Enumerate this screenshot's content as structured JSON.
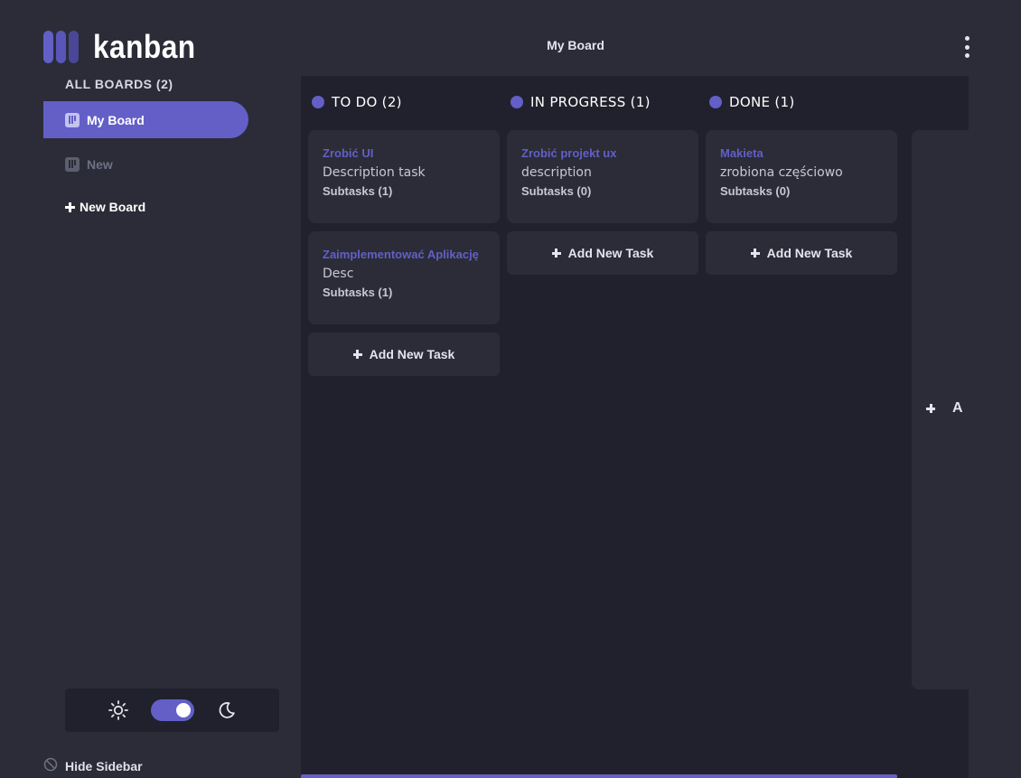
{
  "app": {
    "logo_text": "kanban",
    "board_title": "My Board"
  },
  "sidebar": {
    "all_boards_label": "ALL BOARDS (2)",
    "boards": [
      {
        "label": "My Board",
        "active": true
      },
      {
        "label": "New",
        "active": false
      }
    ],
    "new_board_label": "New Board",
    "hide_sidebar_label": "Hide Sidebar",
    "theme": {
      "mode": "dark",
      "light_icon": "sun-icon",
      "dark_icon": "moon-icon"
    }
  },
  "columns": [
    {
      "header": "TO DO (2)",
      "tasks": [
        {
          "title": "Zrobić UI",
          "description": "Description task",
          "subtasks": "Subtasks (1)"
        },
        {
          "title": "Zaimplementować Aplikację",
          "description": "Desc",
          "subtasks": "Subtasks (1)"
        }
      ],
      "add_task_label": "Add New Task"
    },
    {
      "header": "IN PROGRESS (1)",
      "tasks": [
        {
          "title": "Zrobić projekt ux",
          "description": "description",
          "subtasks": "Subtasks (0)"
        }
      ],
      "add_task_label": "Add New Task"
    },
    {
      "header": "DONE (1)",
      "tasks": [
        {
          "title": "Makieta",
          "description": "zrobiona częściowo",
          "subtasks": "Subtasks (0)"
        }
      ],
      "add_task_label": "Add New Task"
    }
  ],
  "new_column": {
    "label": "A"
  },
  "colors": {
    "accent": "#635fc7",
    "background": "#2b2c37",
    "board_background": "#20212c"
  }
}
